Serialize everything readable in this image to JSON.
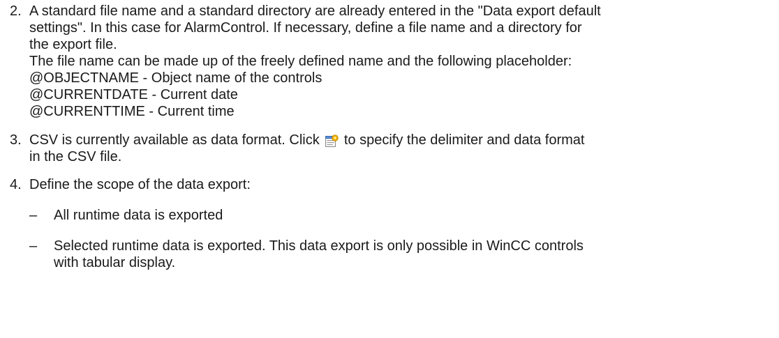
{
  "steps": [
    {
      "number": "2.",
      "lines": [
        "A standard file name and a standard directory are already entered in the \"Data export default",
        "settings\". In this case for AlarmControl. If necessary, define a file name and a directory for",
        "the export file.",
        "The file name can be made up of the freely defined name and the following placeholder:",
        "@OBJECTNAME - Object name of the controls",
        "@CURRENTDATE - Current date",
        "@CURRENTTIME - Current time"
      ]
    },
    {
      "number": "3.",
      "line1_before_icon": "CSV is currently available as data format. Click",
      "line1_after_icon": "to specify the delimiter and data format",
      "line2": "in the CSV file.",
      "icon": "csv-settings-icon"
    },
    {
      "number": "4.",
      "lines": [
        "Define the scope of the data export:"
      ],
      "subitems": [
        {
          "dash": "–",
          "lines": [
            "All runtime data is exported"
          ]
        },
        {
          "dash": "–",
          "lines": [
            "Selected runtime data is exported. This data export is only possible in WinCC controls",
            "with tabular display."
          ]
        }
      ]
    }
  ]
}
